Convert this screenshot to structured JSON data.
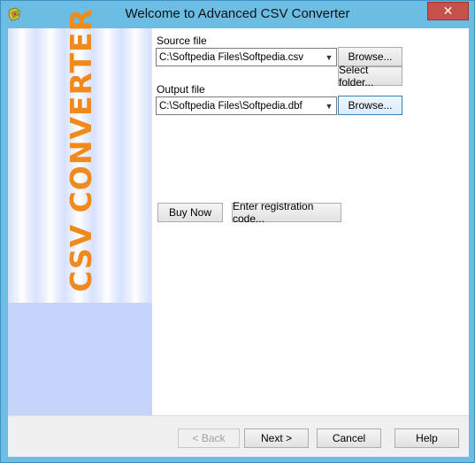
{
  "window": {
    "title": "Welcome to Advanced CSV Converter",
    "close_glyph": "✕",
    "app_icon": "csv-converter-app-icon"
  },
  "side_panel": {
    "banner_text": "CSV CONVERTER",
    "banner_color": "#f08a1c"
  },
  "source": {
    "label": "Source file",
    "value": "C:\\Softpedia Files\\Softpedia.csv",
    "browse_label": "Browse...",
    "select_folder_label": "Select folder..."
  },
  "output": {
    "label": "Output file",
    "value": "C:\\Softpedia Files\\Softpedia.dbf",
    "browse_label": "Browse..."
  },
  "actions": {
    "buy_now_label": "Buy Now",
    "register_label": "Enter registration code..."
  },
  "footer": {
    "back_label": "< Back",
    "next_label": "Next >",
    "cancel_label": "Cancel",
    "help_label": "Help"
  }
}
